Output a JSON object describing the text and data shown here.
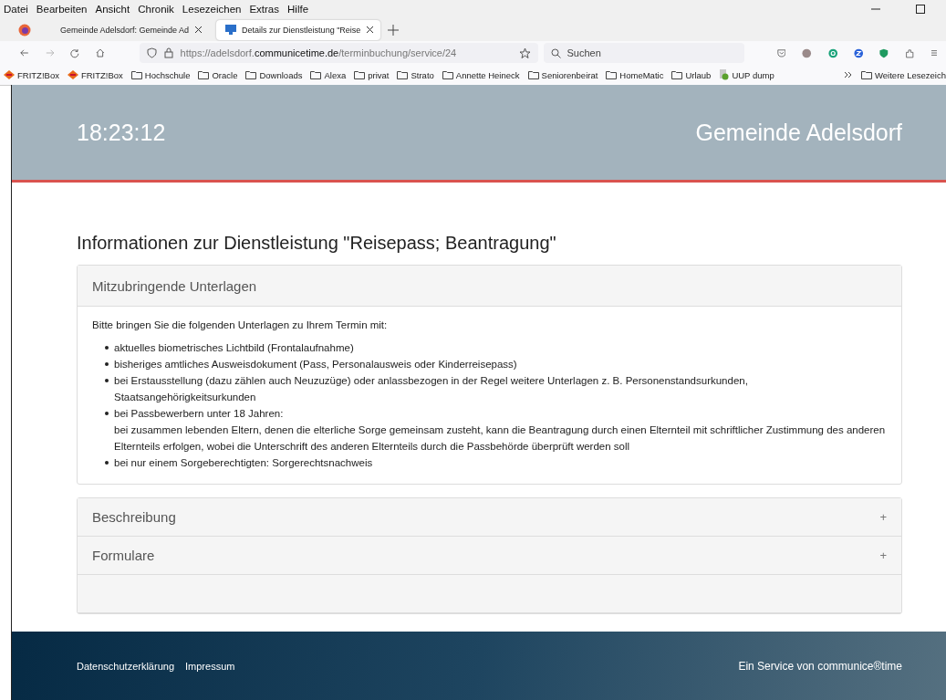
{
  "menu": [
    "Datei",
    "Bearbeiten",
    "Ansicht",
    "Chronik",
    "Lesezeichen",
    "Extras",
    "Hilfe"
  ],
  "tabs": [
    {
      "label": "Gemeinde Adelsdorf: Gemeinde Ad",
      "selected": false
    },
    {
      "label": "Details zur Dienstleistung \"Reise",
      "selected": true
    }
  ],
  "address": {
    "url": "https://adelsdorf.**communicetime.de**/terminbuchung/service/24"
  },
  "search": {
    "placeholder": "Suchen"
  },
  "bookmarks": [
    {
      "label": "FRITZ!Box",
      "kind": "router"
    },
    {
      "label": "FRITZ!Box",
      "kind": "router"
    },
    {
      "label": "Hochschule",
      "kind": "folder"
    },
    {
      "label": "Oracle",
      "kind": "folder"
    },
    {
      "label": "Downloads",
      "kind": "folder"
    },
    {
      "label": "Alexa",
      "kind": "folder"
    },
    {
      "label": "privat",
      "kind": "folder"
    },
    {
      "label": "Strato",
      "kind": "folder"
    },
    {
      "label": "Annette Heineck",
      "kind": "folder"
    },
    {
      "label": "Seniorenbeirat",
      "kind": "folder"
    },
    {
      "label": "HomeMatic",
      "kind": "folder"
    },
    {
      "label": "Urlaub",
      "kind": "folder"
    },
    {
      "label": "UUP dump",
      "kind": "app"
    }
  ],
  "more_bookmarks": {
    "label": "Weitere Lesezeich"
  },
  "header": {
    "time": "18:23:12",
    "title": "Gemeinde Adelsdorf"
  },
  "page_title": "Informationen zur Dienstleistung \"Reisepass; Beantragung\"",
  "sections": [
    {
      "title": "Mitzubringende Unterlagen",
      "expanded": true,
      "intro": "Bitte bringen Sie die folgenden Unterlagen zu Ihrem Termin mit:",
      "items": [
        [
          "aktuelles biometrisches Lichtbild (Frontalaufnahme)"
        ],
        [
          "bisheriges amtliches Ausweisdokument (Pass, Personalausweis oder Kinderreisepass)"
        ],
        [
          "bei Erstausstellung (dazu zählen auch Neuzuzüge) oder anlassbezogen in der Regel weitere Unterlagen z. B. Personenstandsurkunden, Staatsangehörigkeitsurkunden"
        ],
        [
          "bei Passbewerbern unter 18 Jahren:",
          "bei zusammen lebenden Eltern, denen die elterliche Sorge gemeinsam zusteht, kann die Beantragung durch einen Elternteil mit schriftlicher Zustimmung des anderen Elternteils erfolgen, wobei die Unterschrift des anderen Elternteils durch die Passbehörde überprüft werden soll"
        ],
        [
          "bei nur einem Sorgeberechtigten: Sorgerechtsnachweis"
        ]
      ]
    },
    {
      "title": "Beschreibung",
      "expanded": false,
      "toggle": "+"
    },
    {
      "title": "Formulare",
      "expanded": false,
      "toggle": "+"
    }
  ],
  "footer": {
    "links": [
      "Datenschutzerklärung",
      "Impressum"
    ],
    "credit": "Ein Service von communice®time"
  }
}
